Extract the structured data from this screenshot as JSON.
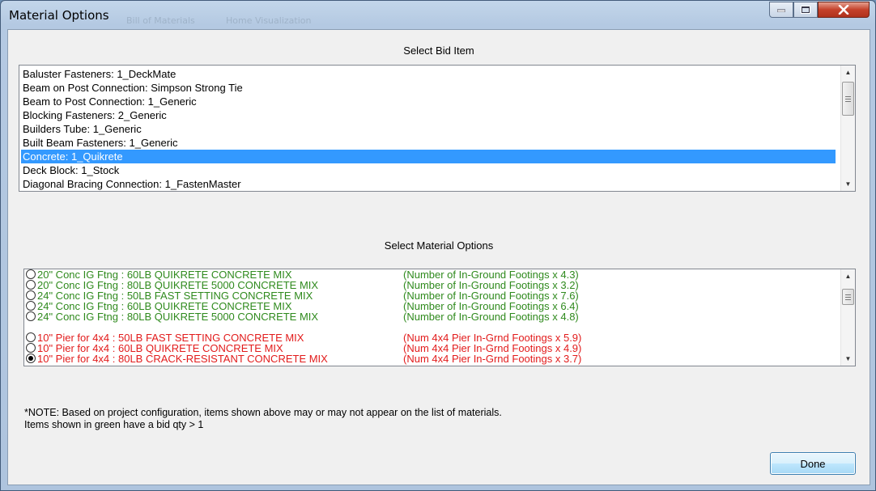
{
  "window": {
    "title": "Material Options",
    "ghost_tabs": [
      "Bill of Materials",
      "Home Visualization"
    ]
  },
  "bid": {
    "heading": "Select Bid Item",
    "items": [
      "Baluster Fasteners: 1_DeckMate",
      "Beam on Post Connection: Simpson Strong Tie",
      "Beam to Post Connection: 1_Generic",
      "Blocking Fasteners: 2_Generic",
      "Builders Tube: 1_Generic",
      "Built Beam Fasteners: 1_Generic",
      "Concrete: 1_Quikrete",
      "Deck Block: 1_Stock",
      "Diagonal Bracing Connection: 1_FastenMaster"
    ],
    "selected": "Concrete: 1_Quikrete"
  },
  "materials": {
    "heading": "Select Material Options",
    "rows": [
      {
        "name": "20\" Conc IG Ftng : 60LB QUIKRETE CONCRETE MIX",
        "qty": "(Number of In-Ground Footings x 4.3)",
        "color": "#2f8a1d",
        "checked": false
      },
      {
        "name": "20\" Conc IG Ftng : 80LB QUIKRETE 5000 CONCRETE MIX",
        "qty": "(Number of In-Ground Footings x 3.2)",
        "color": "#2f8a1d",
        "checked": false
      },
      {
        "name": "24\" Conc IG Ftng : 50LB FAST SETTING CONCRETE MIX",
        "qty": "(Number of In-Ground Footings x 7.6)",
        "color": "#2f8a1d",
        "checked": false
      },
      {
        "name": "24\" Conc IG Ftng : 60LB QUIKRETE CONCRETE MIX",
        "qty": "(Number of In-Ground Footings x 6.4)",
        "color": "#2f8a1d",
        "checked": false
      },
      {
        "name": "24\" Conc IG Ftng : 80LB QUIKRETE 5000 CONCRETE MIX",
        "qty": "(Number of In-Ground Footings x 4.8)",
        "color": "#2f8a1d",
        "checked": false
      },
      {
        "name": "10\" Pier for 4x4 : 50LB FAST SETTING CONCRETE MIX",
        "qty": "(Num 4x4 Pier In-Grnd Footings x 5.9)",
        "color": "#e21b1b",
        "checked": false
      },
      {
        "name": "10\" Pier for 4x4 : 60LB QUIKRETE CONCRETE MIX",
        "qty": "(Num 4x4 Pier In-Grnd Footings x 4.9)",
        "color": "#e21b1b",
        "checked": false
      },
      {
        "name": "10\" Pier for 4x4 : 80LB CRACK-RESISTANT CONCRETE MIX",
        "qty": "(Num 4x4 Pier In-Grnd Footings x 3.7)",
        "color": "#e21b1b",
        "checked": true
      }
    ]
  },
  "note": {
    "line1": "*NOTE:  Based on project configuration, items shown above may or may not appear on the list of materials.",
    "line2": "Items shown in green have a bid qty > 1"
  },
  "buttons": {
    "done": "Done"
  },
  "icons": {
    "minimize": "minimize-icon",
    "maximize": "maximize-icon",
    "close": "close-icon",
    "scroll_up": "arrow-up-icon",
    "scroll_down": "arrow-down-icon"
  }
}
